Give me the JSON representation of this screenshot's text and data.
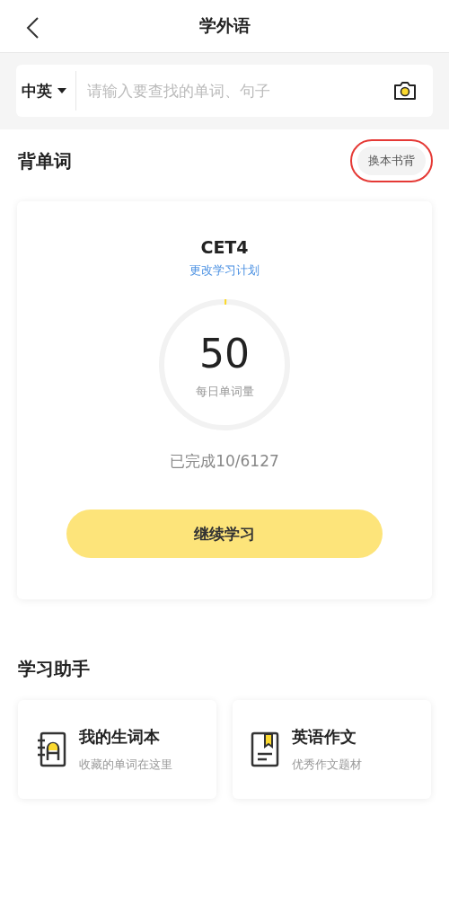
{
  "header": {
    "title": "学外语"
  },
  "search": {
    "language": "中英",
    "placeholder": "请输入要查找的单词、句子"
  },
  "vocab": {
    "title": "背单词",
    "switch_button": {
      "label": "换本书背",
      "highlighted": true
    },
    "book": "CET4",
    "change_plan": "更改学习计划",
    "daily_count": "50",
    "daily_label": "每日单词量",
    "level": 0.005,
    "progress": "已完成10/6127",
    "continue_button": "继续学习"
  },
  "assistant": {
    "title": "学习助手",
    "items": [
      {
        "kind": "notebook",
        "title": "我的生词本",
        "subtitle": "收藏的单词在这里"
      },
      {
        "kind": "composition",
        "title": "英语作文",
        "subtitle": "优秀作文题材"
      }
    ]
  }
}
